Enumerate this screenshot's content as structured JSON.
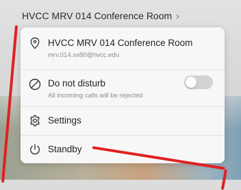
{
  "header": {
    "title": "HVCC MRV 014 Conference Room",
    "chevron_icon": "chevron-right-icon"
  },
  "menu": {
    "location": {
      "icon": "location-pin-icon",
      "name": "HVCC MRV 014 Conference Room",
      "address": "mrv.014.sx80@hvcc.edu"
    },
    "do_not_disturb": {
      "icon": "do-not-disturb-icon",
      "label": "Do not disturb",
      "description": "All incoming calls will be rejected",
      "enabled": false
    },
    "settings": {
      "icon": "gear-icon",
      "label": "Settings"
    },
    "standby": {
      "icon": "power-icon",
      "label": "Standby"
    }
  },
  "colors": {
    "annotation": "#e02020",
    "menu_background": "#f7f7f7",
    "toggle_off": "#d2d2d2"
  }
}
